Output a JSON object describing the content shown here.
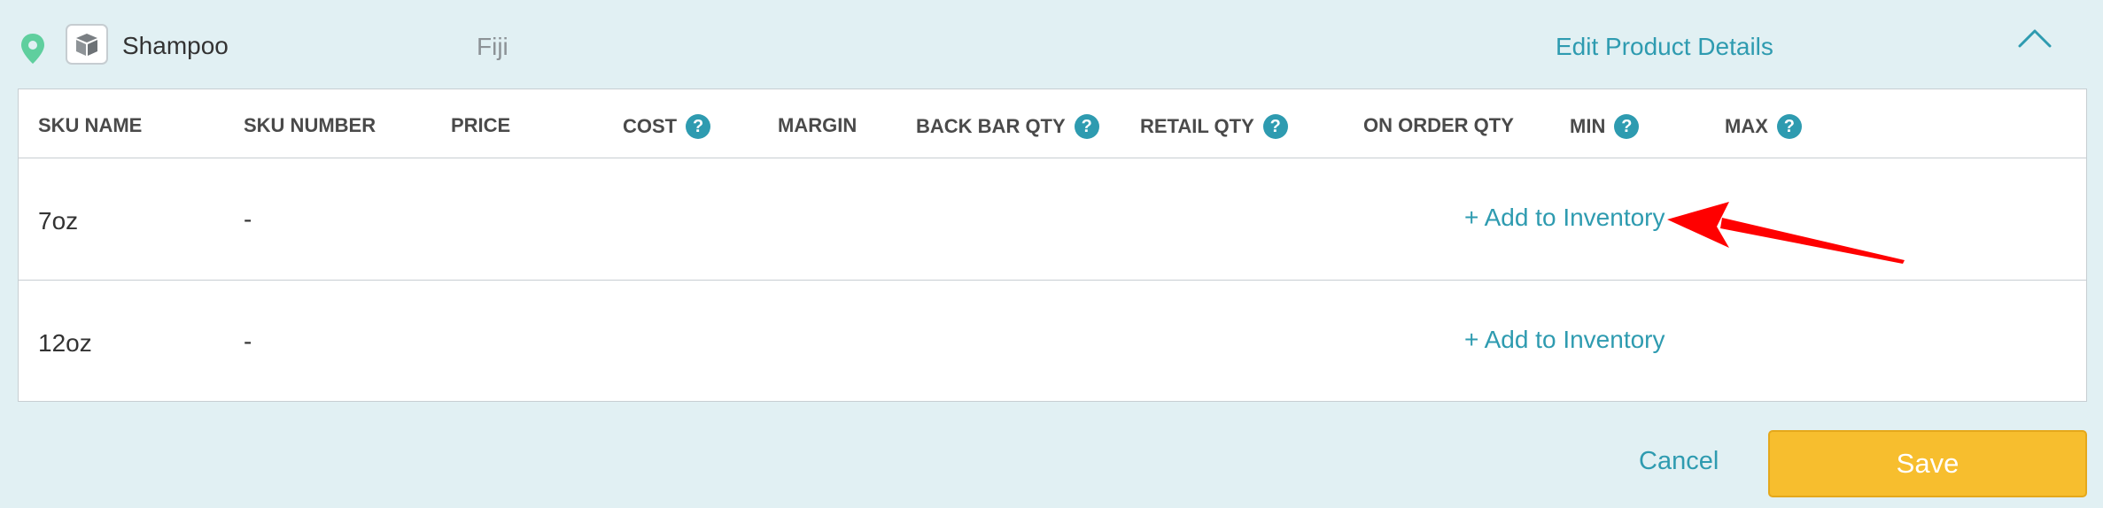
{
  "header": {
    "product_name": "Shampoo",
    "location": "Fiji",
    "edit_link": "Edit Product Details"
  },
  "table": {
    "columns": [
      {
        "label": "SKU NAME",
        "help": false
      },
      {
        "label": "SKU NUMBER",
        "help": false
      },
      {
        "label": "PRICE",
        "help": false
      },
      {
        "label": "COST",
        "help": true
      },
      {
        "label": "MARGIN",
        "help": false
      },
      {
        "label": "BACK BAR QTY",
        "help": true
      },
      {
        "label": "RETAIL QTY",
        "help": true
      },
      {
        "label": "ON ORDER QTY",
        "help": false
      },
      {
        "label": "MIN",
        "help": true
      },
      {
        "label": "MAX",
        "help": true
      }
    ],
    "help_glyph": "?",
    "rows": [
      {
        "sku_name": "7oz",
        "sku_number": "-",
        "action": "+ Add to Inventory"
      },
      {
        "sku_name": "12oz",
        "sku_number": "-",
        "action": "+ Add to Inventory"
      }
    ]
  },
  "footer": {
    "cancel_label": "Cancel",
    "save_label": "Save"
  },
  "colors": {
    "background": "#e1f0f3",
    "accent": "#2e9bb0",
    "save_button": "#f7be2e",
    "pin": "#5fcf9e",
    "annotation_arrow": "#ff0000"
  },
  "icons": {
    "pin": "location-pin-icon",
    "product": "box-icon",
    "collapse": "chevron-up-icon",
    "help": "help-icon"
  }
}
